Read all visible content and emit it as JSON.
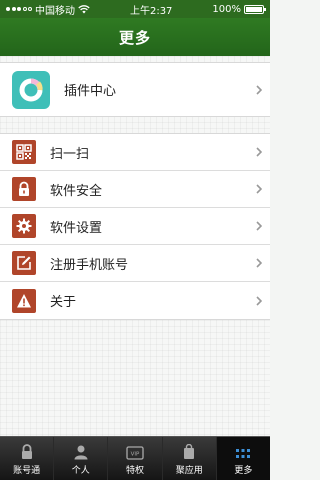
{
  "statusbar": {
    "carrier": "中国移动",
    "time": "上午2:37",
    "battery": "100%"
  },
  "navbar": {
    "title": "更多"
  },
  "plugin": {
    "label": "插件中心"
  },
  "menu": [
    {
      "label": "扫一扫",
      "icon": "qr-code-icon"
    },
    {
      "label": "软件安全",
      "icon": "lock-icon"
    },
    {
      "label": "软件设置",
      "icon": "gear-icon"
    },
    {
      "label": "注册手机账号",
      "icon": "edit-icon"
    },
    {
      "label": "关于",
      "icon": "warning-icon"
    }
  ],
  "tabs": [
    {
      "label": "账号通",
      "icon": "lock-icon"
    },
    {
      "label": "个人",
      "icon": "person-icon"
    },
    {
      "label": "特权",
      "icon": "vip-card-icon"
    },
    {
      "label": "聚应用",
      "icon": "bag-icon"
    },
    {
      "label": "更多",
      "icon": "grid-dots-icon",
      "active": true
    }
  ],
  "colors": {
    "nav": "#2d6b1f",
    "icon_bg": "#b0452a",
    "plugin": "#3fbfb8",
    "active_tab_icon": "#3d8fd6"
  }
}
